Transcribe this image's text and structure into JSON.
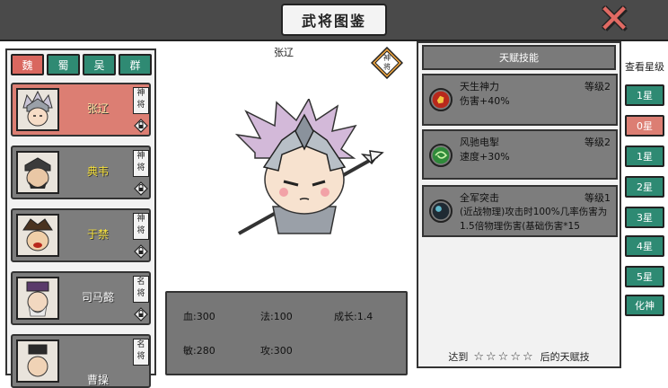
{
  "header": {
    "title": "武将图鉴",
    "close_icon": "close-x-icon",
    "close_color": "#e06a63"
  },
  "factions": [
    {
      "label": "魏",
      "active": true
    },
    {
      "label": "蜀",
      "active": false
    },
    {
      "label": "吴",
      "active": false
    },
    {
      "label": "群",
      "active": false
    }
  ],
  "heroes": [
    {
      "name": "张辽",
      "rank": "神将",
      "selected": true
    },
    {
      "name": "典韦",
      "rank": "神将",
      "selected": false
    },
    {
      "name": "于禁",
      "rank": "神将",
      "selected": false
    },
    {
      "name": "司马懿",
      "rank": "名将",
      "selected": false
    },
    {
      "name": "曹操",
      "rank": "名将",
      "selected": false
    }
  ],
  "hero_detail": {
    "name": "张辽",
    "badge": "神将",
    "stats": {
      "hp": "血:300",
      "mp": "法:100",
      "growth": "成长:1.4",
      "agility": "敏:280",
      "attack": "攻:300"
    }
  },
  "talents": {
    "header": "天赋技能",
    "skills": [
      {
        "name": "天生神力",
        "level": "等级2",
        "desc": "伤害+40%",
        "icon": "power-fist-icon",
        "color": "#b8281c"
      },
      {
        "name": "风驰电掣",
        "level": "等级2",
        "desc": "速度+30%",
        "icon": "wind-swirl-icon",
        "color": "#2f8a3a"
      },
      {
        "name": "全军突击",
        "level": "等级1",
        "desc": "(近战物理)攻击时100%几率伤害为1.5倍物理伤害(基础伤害*15",
        "icon": "charge-icon",
        "color": "#1f2a33"
      }
    ],
    "footer_prefix": "达到",
    "footer_stars": "☆☆☆☆☆",
    "footer_suffix": "后的天赋技"
  },
  "star_levels": {
    "title": "查看星级",
    "buttons": [
      {
        "label": "1星",
        "active": false
      },
      {
        "label": "0星",
        "active": true
      },
      {
        "label": "1星",
        "active": false
      },
      {
        "label": "2星",
        "active": false
      },
      {
        "label": "3星",
        "active": false
      },
      {
        "label": "4星",
        "active": false
      },
      {
        "label": "5星",
        "active": false
      },
      {
        "label": "化神",
        "active": false
      }
    ]
  }
}
